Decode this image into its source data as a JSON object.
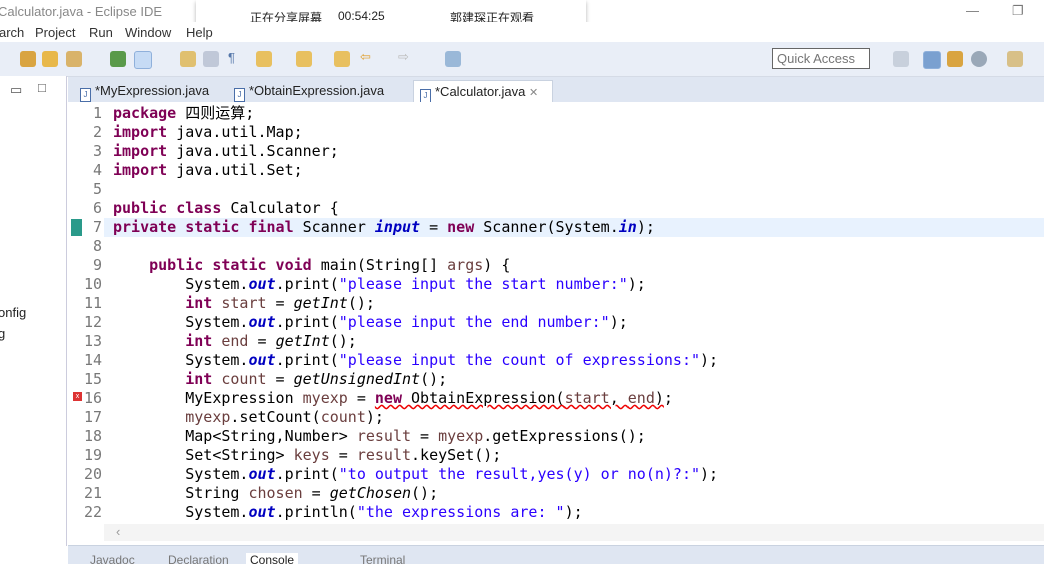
{
  "window": {
    "title": "Calculator.java - Eclipse IDE"
  },
  "share_overlay": {
    "status": "正在分享屏幕",
    "time": "00:54:25",
    "viewer": "郭建琛正在观看"
  },
  "menu": [
    "arch",
    "Project",
    "Run",
    "Window",
    "Help"
  ],
  "quick_access": {
    "placeholder": "Quick Access"
  },
  "left_panel": {
    "items": [
      "onfig",
      "g"
    ]
  },
  "tabs": [
    {
      "label": "*MyExpression.java",
      "active": false
    },
    {
      "label": "*ObtainExpression.java",
      "active": false
    },
    {
      "label": "*Calculator.java",
      "active": true
    }
  ],
  "bottom_tabs": [
    "Javadoc",
    "Declaration",
    "Console",
    "Terminal"
  ],
  "colors": {
    "keyword": "#7f0055",
    "string": "#2a00ff",
    "field": "#0000c0",
    "toolbar": "#e9eef7"
  },
  "code": [
    [
      [
        "k",
        "package"
      ],
      [
        "p",
        " 四则运算;"
      ]
    ],
    [
      [
        "k",
        "import"
      ],
      [
        "p",
        " java.util.Map;"
      ]
    ],
    [
      [
        "k",
        "import"
      ],
      [
        "p",
        " java.util.Scanner;"
      ]
    ],
    [
      [
        "k",
        "import"
      ],
      [
        "p",
        " java.util.Set;"
      ]
    ],
    [],
    [
      [
        "k",
        "public class"
      ],
      [
        "p",
        " Calculator {"
      ]
    ],
    [
      [
        "k",
        "private static final"
      ],
      [
        "p",
        " Scanner "
      ],
      [
        "f",
        "input"
      ],
      [
        "p",
        " = "
      ],
      [
        "k",
        "new"
      ],
      [
        "p",
        " Scanner(System."
      ],
      [
        "f",
        "in"
      ],
      [
        "p",
        ");"
      ]
    ],
    [],
    [
      [
        "p",
        "    "
      ],
      [
        "k",
        "public static void"
      ],
      [
        "p",
        " main(String[] "
      ],
      [
        "v",
        "args"
      ],
      [
        "p",
        ") {"
      ]
    ],
    [
      [
        "p",
        "        System."
      ],
      [
        "f",
        "out"
      ],
      [
        "p",
        ".print("
      ],
      [
        "s",
        "\"please input the start number:\""
      ],
      [
        "p",
        ");"
      ]
    ],
    [
      [
        "p",
        "        "
      ],
      [
        "k",
        "int"
      ],
      [
        "p",
        " "
      ],
      [
        "v",
        "start"
      ],
      [
        "p",
        " = "
      ],
      [
        "m",
        "getInt"
      ],
      [
        "p",
        "();"
      ]
    ],
    [
      [
        "p",
        "        System."
      ],
      [
        "f",
        "out"
      ],
      [
        "p",
        ".print("
      ],
      [
        "s",
        "\"please input the end number:\""
      ],
      [
        "p",
        ");"
      ]
    ],
    [
      [
        "p",
        "        "
      ],
      [
        "k",
        "int"
      ],
      [
        "p",
        " "
      ],
      [
        "v",
        "end"
      ],
      [
        "p",
        " = "
      ],
      [
        "m",
        "getInt"
      ],
      [
        "p",
        "();"
      ]
    ],
    [
      [
        "p",
        "        System."
      ],
      [
        "f",
        "out"
      ],
      [
        "p",
        ".print("
      ],
      [
        "s",
        "\"please input the count of expressions:\""
      ],
      [
        "p",
        ");"
      ]
    ],
    [
      [
        "p",
        "        "
      ],
      [
        "k",
        "int"
      ],
      [
        "p",
        " "
      ],
      [
        "v",
        "count"
      ],
      [
        "p",
        " = "
      ],
      [
        "m",
        "getUnsignedInt"
      ],
      [
        "p",
        "();"
      ]
    ],
    [
      [
        "p",
        "        MyExpression "
      ],
      [
        "v",
        "myexp"
      ],
      [
        "p",
        " = "
      ],
      [
        "ke",
        "new"
      ],
      [
        "e",
        " ObtainExpression("
      ],
      [
        "ve",
        "start"
      ],
      [
        "e",
        ", "
      ],
      [
        "ve",
        "end"
      ],
      [
        "e",
        ")"
      ],
      [
        "p",
        ";"
      ]
    ],
    [
      [
        "p",
        "        "
      ],
      [
        "v",
        "myexp"
      ],
      [
        "p",
        ".setCount("
      ],
      [
        "v",
        "count"
      ],
      [
        "p",
        ");"
      ]
    ],
    [
      [
        "p",
        "        Map<String,Number> "
      ],
      [
        "v",
        "result"
      ],
      [
        "p",
        " = "
      ],
      [
        "v",
        "myexp"
      ],
      [
        "p",
        ".getExpressions();"
      ]
    ],
    [
      [
        "p",
        "        Set<String> "
      ],
      [
        "v",
        "keys"
      ],
      [
        "p",
        " = "
      ],
      [
        "v",
        "result"
      ],
      [
        "p",
        ".keySet();"
      ]
    ],
    [
      [
        "p",
        "        System."
      ],
      [
        "f",
        "out"
      ],
      [
        "p",
        ".print("
      ],
      [
        "s",
        "\"to output the result,yes(y) or no(n)?:\""
      ],
      [
        "p",
        ");"
      ]
    ],
    [
      [
        "p",
        "        String "
      ],
      [
        "v",
        "chosen"
      ],
      [
        "p",
        " = "
      ],
      [
        "m",
        "getChosen"
      ],
      [
        "p",
        "();"
      ]
    ],
    [
      [
        "p",
        "        System."
      ],
      [
        "f",
        "out"
      ],
      [
        "p",
        ".println("
      ],
      [
        "s",
        "\"the expressions are: \""
      ],
      [
        "p",
        ");"
      ]
    ]
  ]
}
